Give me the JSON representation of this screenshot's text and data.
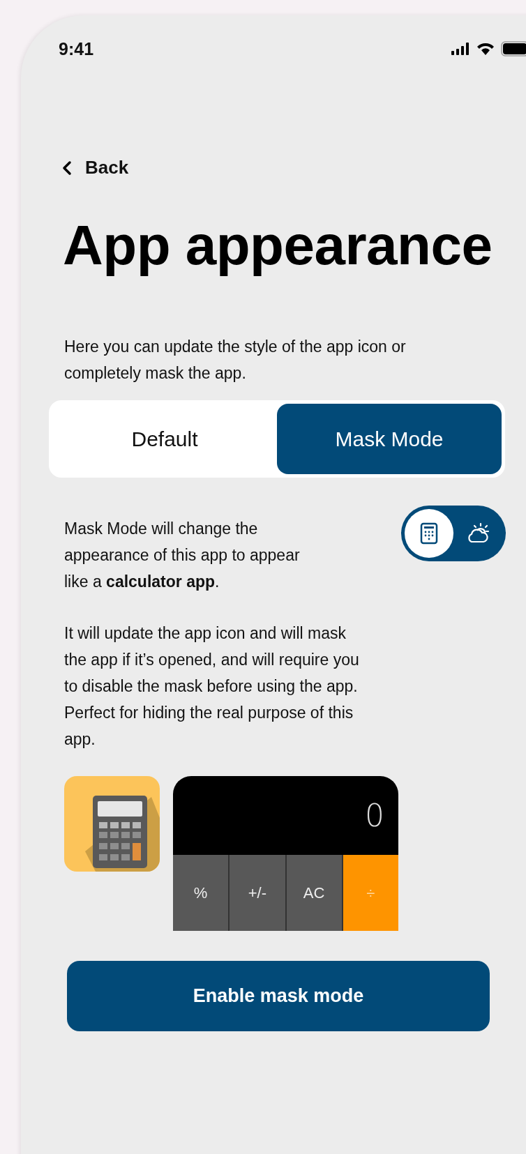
{
  "status_bar": {
    "time": "9:41"
  },
  "back": {
    "label": "Back"
  },
  "title": "App appearance",
  "intro": "Here you can update the style of the app icon or completely mask the app.",
  "tabs": [
    {
      "label": "Default",
      "selected": false
    },
    {
      "label": "Mask Mode",
      "selected": true
    }
  ],
  "mask_description": "Mask Mode will change the appearance of this app to appear like a **calculator app**.",
  "icon_switch": [
    {
      "kind": "calculator",
      "selected": true
    },
    {
      "kind": "weather",
      "selected": false
    }
  ],
  "details": "It will update the app icon and will mask the app if it’s opened, and will require you to disable the mask before using the app. Perfect for hiding the real purpose of this app.",
  "calculator_preview": {
    "display": "0",
    "keys": [
      {
        "label": "%",
        "kind": "function"
      },
      {
        "label": "+/-",
        "kind": "function"
      },
      {
        "label": "AC",
        "kind": "function"
      },
      {
        "label": "÷",
        "kind": "operator"
      }
    ]
  },
  "primary_button": {
    "label": "Enable mask mode"
  }
}
